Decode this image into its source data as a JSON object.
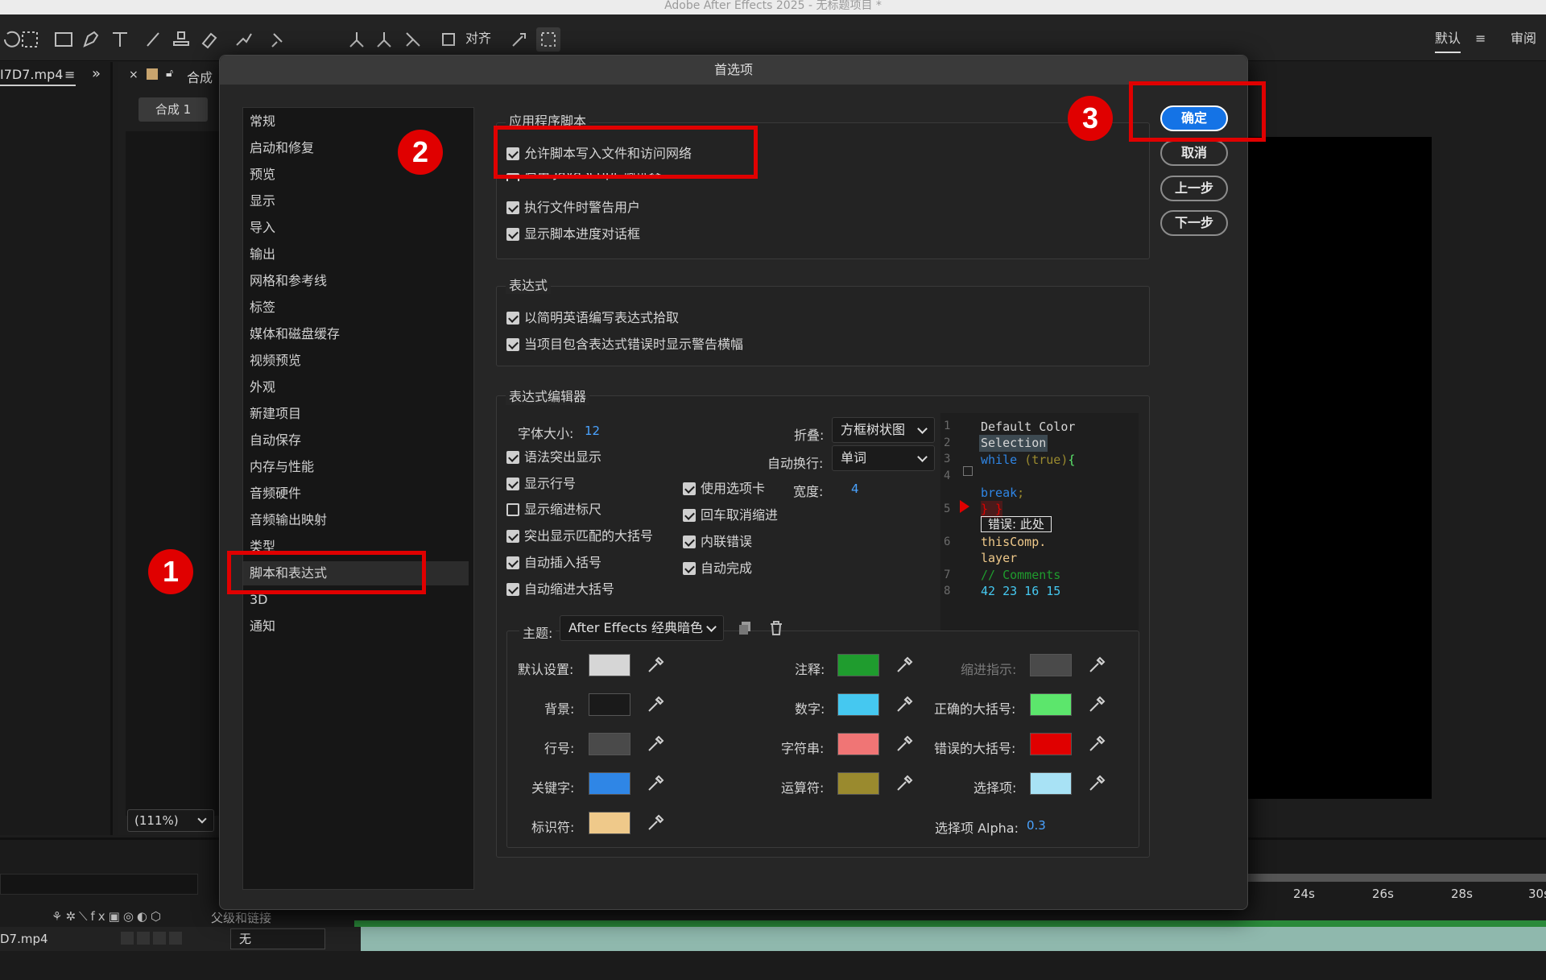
{
  "window_title": "Adobe After Effects 2025 - 无标题项目 *",
  "toolbar": {
    "align_label": "对齐",
    "workspace_default": "默认",
    "workspace_review": "审阅"
  },
  "left_panel": {
    "tab": "I7D7.mp4"
  },
  "comp_panel": {
    "tab": "合成",
    "chip": "合成 1",
    "zoom": "(111%)"
  },
  "timeline": {
    "ticks": [
      "24s",
      "26s",
      "28s",
      "30s"
    ],
    "parent_label": "父级和链接",
    "layer_name": "D7.mp4",
    "parent_value": "无"
  },
  "dialog": {
    "title": "首选项",
    "categories": [
      "常规",
      "启动和修复",
      "预览",
      "显示",
      "导入",
      "输出",
      "网格和参考线",
      "标签",
      "媒体和磁盘缓存",
      "视频预览",
      "外观",
      "新建项目",
      "自动保存",
      "内存与性能",
      "音频硬件",
      "音频输出映射",
      "类型",
      "脚本和表达式",
      "3D",
      "通知"
    ],
    "buttons": {
      "ok": "确定",
      "cancel": "取消",
      "prev": "上一步",
      "next": "下一步"
    },
    "scripts": {
      "group_label": "应用程序脚本",
      "allow_write": "允许脚本写入文件和访问网络",
      "enable_debugger": "启用 JavaScript 调试器",
      "warn_exec": "执行文件时警告用户",
      "show_progress": "显示脚本进度对话框"
    },
    "expressions": {
      "group_label": "表达式",
      "plain_english": "以简明英语编写表达式拾取",
      "warn_banner": "当项目包含表达式错误时显示警告横幅"
    },
    "editor": {
      "group_label": "表达式编辑器",
      "font_size_label": "字体大小:",
      "font_size_value": "12",
      "fold_label": "折叠:",
      "fold_value": "方框树状图",
      "wrap_label": "自动换行:",
      "wrap_value": "单词",
      "syntax": "语法突出显示",
      "line_numbers": "显示行号",
      "indent_ruler": "显示缩进标尺",
      "match_brackets": "突出显示匹配的大括号",
      "auto_insert": "自动插入括号",
      "auto_indent": "自动缩进大括号",
      "use_tabs": "使用选项卡",
      "tab_width_label": "宽度:",
      "tab_width_value": "4",
      "backspace_unindent": "回车取消缩进",
      "inline_errors": "内联错误",
      "autocomplete": "自动完成",
      "preview": {
        "line_numbers": [
          "1",
          "2",
          "3",
          "4",
          "5",
          "6",
          "7",
          "8"
        ],
        "default_color": "Default Color",
        "selection": "Selection",
        "while_kw": "while",
        "true_kw": "(true)",
        "brace_open": "{",
        "break_kw": "break",
        "semicolon": ";",
        "error_braces": "} }",
        "error_label": "错误: 此处",
        "this_comp": "thisComp.",
        "layer": "layer",
        "comment": "// Comments",
        "numbers": "42 23 16 15"
      }
    },
    "theme": {
      "label": "主题:",
      "value": "After Effects 经典暗色",
      "default_label": "默认设置:",
      "background_label": "背景:",
      "line_num_label": "行号:",
      "keyword_label": "关键字:",
      "identifier_label": "标识符:",
      "comment_label": "注释:",
      "number_label": "数字:",
      "string_label": "字符串:",
      "operator_label": "运算符:",
      "indent_label": "缩进指示:",
      "correct_brace_label": "正确的大括号:",
      "error_brace_label": "错误的大括号:",
      "selection_label": "选择项:",
      "alpha_label": "选择项 Alpha:",
      "alpha_value": "0.3",
      "colors": {
        "default": "#d6d6d6",
        "background": "#1a1a1a",
        "line_num": "#4a4a4a",
        "keyword": "#2f86e6",
        "identifier": "#efc98a",
        "comment": "#1f9c2e",
        "number": "#45c8f0",
        "string": "#f07575",
        "operator": "#9a8a2e",
        "indent": "#4a4a4a",
        "correct_brace": "#5ce66c",
        "error_brace": "#e00000",
        "selection": "#a8e2f5"
      }
    }
  },
  "annotations": {
    "step1": "1",
    "step2": "2",
    "step3": "3"
  }
}
